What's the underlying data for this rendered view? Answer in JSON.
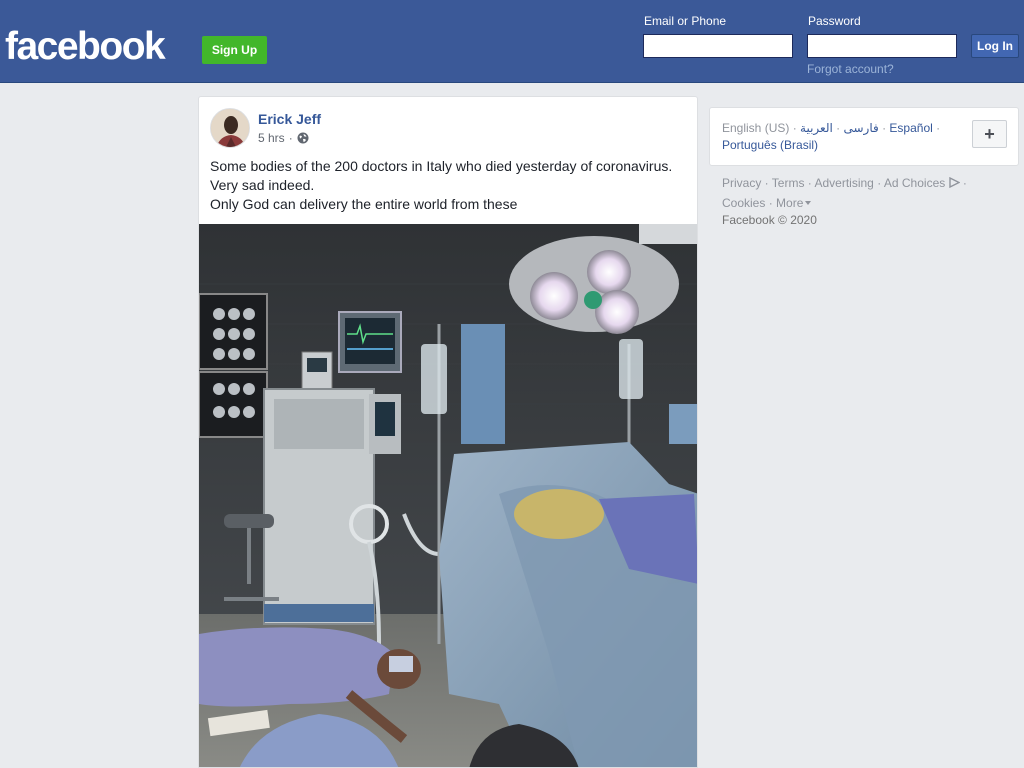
{
  "header": {
    "logo": "facebook",
    "signup_label": "Sign Up",
    "email_label": "Email or Phone",
    "password_label": "Password",
    "login_label": "Log In",
    "forgot_label": "Forgot account?",
    "email_value": "",
    "password_value": ""
  },
  "post": {
    "author": "Erick Jeff",
    "time": "5 hrs",
    "separator": "·",
    "privacy_icon": "globe-icon",
    "text_lines": [
      "Some bodies of the 200 doctors in Italy who died yesterday of coronavirus.",
      "Very sad indeed.",
      "Only God can delivery the entire world from these"
    ]
  },
  "languages": {
    "current": "English (US)",
    "items": [
      "فارسی",
      "العربية",
      "Español",
      "Português (Brasil)"
    ],
    "sep": " · ",
    "more_icon": "plus-icon"
  },
  "footer": {
    "links": [
      "Privacy",
      "Terms",
      "Advertising",
      "Ad Choices",
      "Cookies",
      "More"
    ],
    "ad_choices_icon": "ad-choices-icon",
    "more_icon": "caret-down-icon",
    "copyright": "Facebook © 2020"
  },
  "colors": {
    "brand": "#3b5998",
    "signup": "#42b72a",
    "link": "#365899"
  }
}
